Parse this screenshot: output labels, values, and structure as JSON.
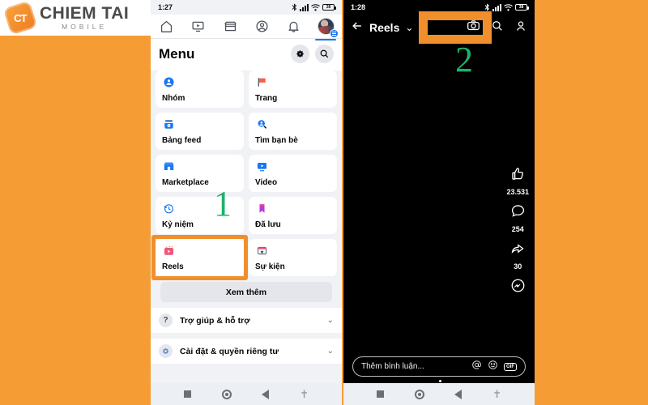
{
  "brand": {
    "badge_text": "CT",
    "name": "CHIEM TAI",
    "tagline": "MOBILE",
    "accent": "#ef8a22"
  },
  "colors": {
    "background_orange": "#f69c34",
    "highlight_orange": "#f18f2c",
    "annotation_green": "#19b36b",
    "facebook_blue": "#1877f2"
  },
  "phone_left": {
    "status": {
      "time": "1:27",
      "battery_text": "38"
    },
    "top_nav": [
      {
        "name": "home",
        "label": "Trang chủ"
      },
      {
        "name": "video",
        "label": "Video"
      },
      {
        "name": "marketplace",
        "label": "Marketplace"
      },
      {
        "name": "profile",
        "label": "Trang cá nhân"
      },
      {
        "name": "notifications",
        "label": "Thông báo"
      },
      {
        "name": "menu",
        "label": "Menu"
      }
    ],
    "header": {
      "title": "Menu",
      "settings_icon": "gear-icon",
      "search_icon": "search-icon"
    },
    "tiles": [
      {
        "label": "Nhóm",
        "icon": "groups-icon"
      },
      {
        "label": "Trang",
        "icon": "flag-icon"
      },
      {
        "label": "Bảng feed",
        "icon": "feed-icon"
      },
      {
        "label": "Tìm bạn bè",
        "icon": "find-friends-icon"
      },
      {
        "label": "Marketplace",
        "icon": "store-icon"
      },
      {
        "label": "Video",
        "icon": "video-icon"
      },
      {
        "label": "Kỷ niệm",
        "icon": "clock-icon"
      },
      {
        "label": "Đã lưu",
        "icon": "bookmark-icon"
      },
      {
        "label": "Reels",
        "icon": "reels-icon"
      },
      {
        "label": "Sự kiện",
        "icon": "events-icon"
      }
    ],
    "see_more": "Xem thêm",
    "rows": [
      {
        "label": "Trợ giúp & hỗ trợ",
        "icon": "question-icon",
        "chevron": "⌄"
      },
      {
        "label": "Cài đặt & quyền riêng tư",
        "icon": "gear-icon",
        "chevron": "⌄"
      }
    ],
    "annotation": "1"
  },
  "phone_right": {
    "status": {
      "time": "1:28",
      "battery_text": "38"
    },
    "top": {
      "back_icon": "arrow-left-icon",
      "title": "Reels",
      "chevron": "⌄",
      "camera_icon": "camera-icon",
      "search_icon": "search-icon",
      "profile_icon": "person-icon"
    },
    "actions": [
      {
        "icon": "like-icon",
        "count": "23.531"
      },
      {
        "icon": "comment-icon",
        "count": "254"
      },
      {
        "icon": "share-icon",
        "count": "30"
      },
      {
        "icon": "messenger-icon",
        "count": ""
      }
    ],
    "comment_bar": {
      "placeholder": "Thêm bình luận...",
      "mention_icon": "at-icon",
      "emoji_icon": "smiley-icon",
      "gif_icon": "gif-icon",
      "gif_label": "GIF"
    },
    "annotation": "2"
  },
  "system_bar": {
    "recent": "square-icon",
    "home": "circle-icon",
    "back": "triangle-back-icon",
    "assistant": "accessibility-icon"
  }
}
